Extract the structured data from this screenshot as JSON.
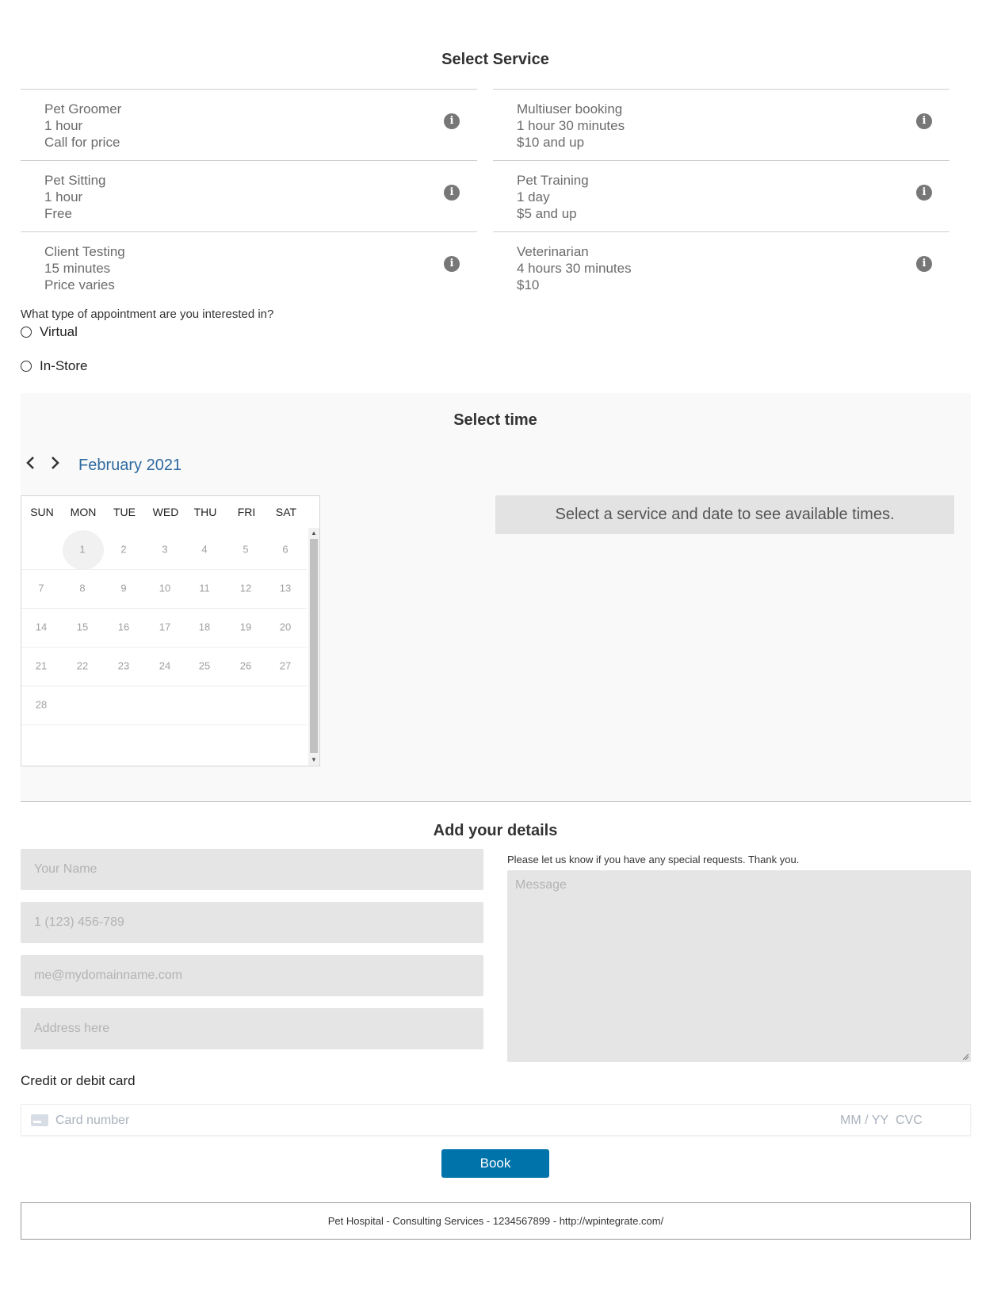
{
  "select_service": {
    "title": "Select Service",
    "services": [
      {
        "name": "Pet Groomer",
        "duration": "1 hour",
        "price": "Call for price"
      },
      {
        "name": "Multiuser booking",
        "duration": "1 hour 30 minutes",
        "price": "$10 and up"
      },
      {
        "name": "Pet Sitting",
        "duration": "1 hour",
        "price": "Free"
      },
      {
        "name": "Pet Training",
        "duration": "1 day",
        "price": "$5 and up"
      },
      {
        "name": "Client Testing",
        "duration": "15 minutes",
        "price": "Price varies"
      },
      {
        "name": "Veterinarian",
        "duration": "4 hours 30 minutes",
        "price": "$10"
      }
    ],
    "info_icon": "info-icon"
  },
  "appointment": {
    "question": "What type of appointment are you interested in?",
    "options": [
      "Virtual",
      "In-Store"
    ]
  },
  "select_time": {
    "title": "Select time",
    "month": "February 2021",
    "weekdays": [
      "SUN",
      "MON",
      "TUE",
      "WED",
      "THU",
      "FRI",
      "SAT"
    ],
    "weeks": [
      [
        "",
        "1",
        "2",
        "3",
        "4",
        "5",
        "6"
      ],
      [
        "7",
        "8",
        "9",
        "10",
        "11",
        "12",
        "13"
      ],
      [
        "14",
        "15",
        "16",
        "17",
        "18",
        "19",
        "20"
      ],
      [
        "21",
        "22",
        "23",
        "24",
        "25",
        "26",
        "27"
      ],
      [
        "28",
        "",
        "",
        "",
        "",
        "",
        ""
      ]
    ],
    "availability_message": "Select a service and date to see available times."
  },
  "details": {
    "title": "Add your details",
    "name_placeholder": "Your Name",
    "phone_placeholder": "1 (123) 456-789",
    "email_placeholder": "me@mydomainname.com",
    "address_placeholder": "Address here",
    "message_label": "Please let us know if you have any special requests. Thank you.",
    "message_placeholder": "Message",
    "card_label": "Credit or debit card",
    "card_number_placeholder": "Card number",
    "card_expiry_placeholder": "MM / YY",
    "card_cvc_placeholder": "CVC",
    "book_label": "Book"
  },
  "footer": {
    "text": "Pet Hospital - Consulting Services - 1234567899 - http://wpintegrate.com/"
  },
  "colors": {
    "accent": "#0073aa",
    "month_link": "#2e6aa0",
    "field_bg": "#e5e5e5"
  }
}
